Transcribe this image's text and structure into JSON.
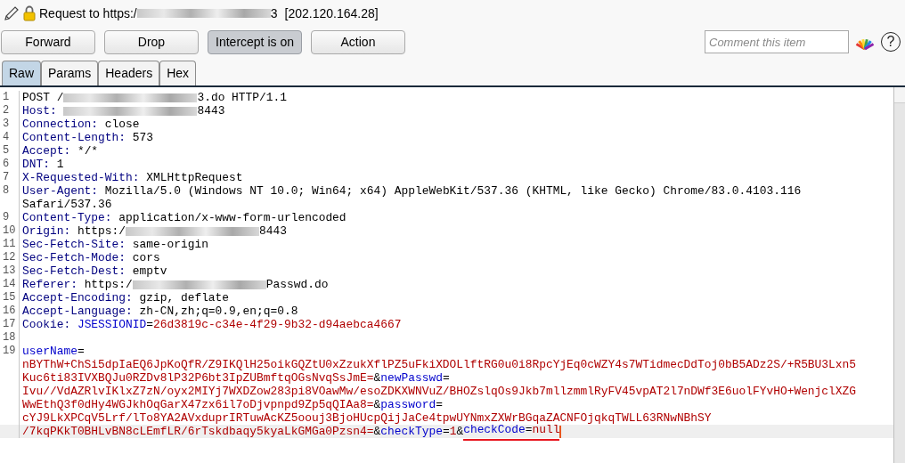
{
  "title": {
    "segments": [
      {
        "kind": "text",
        "text": "Request to https:/"
      },
      {
        "kind": "redacted"
      },
      {
        "kind": "text",
        "text": "3"
      }
    ],
    "address": "[202.120.164.28]"
  },
  "buttons": [
    {
      "label": "Forward",
      "pressed": false
    },
    {
      "label": "Drop",
      "pressed": false
    },
    {
      "label": "Intercept is on",
      "pressed": true
    },
    {
      "label": "Action",
      "pressed": false
    }
  ],
  "comment": {
    "placeholder": "Comment this item"
  },
  "help": "?",
  "tabs": [
    {
      "label": "Raw",
      "selected": true
    },
    {
      "label": "Params",
      "selected": false
    },
    {
      "label": "Headers",
      "selected": false
    },
    {
      "label": "Hex",
      "selected": false
    }
  ],
  "editor": {
    "rows": [
      {
        "number": "1",
        "current": false,
        "segments": [
          {
            "kind": "plain",
            "text": "POST /"
          },
          {
            "kind": "redacted"
          },
          {
            "kind": "plain",
            "text": "3.do HTTP/1.1"
          }
        ]
      },
      {
        "number": "2",
        "current": false,
        "segments": [
          {
            "kind": "name",
            "text": "Host: "
          },
          {
            "kind": "redacted"
          },
          {
            "kind": "plain",
            "text": "8443"
          }
        ]
      },
      {
        "number": "3",
        "current": false,
        "segments": [
          {
            "kind": "name",
            "text": "Connection:"
          },
          {
            "kind": "plain",
            "text": " close"
          }
        ]
      },
      {
        "number": "4",
        "current": false,
        "segments": [
          {
            "kind": "name",
            "text": "Content-Length:"
          },
          {
            "kind": "plain",
            "text": " 573"
          }
        ]
      },
      {
        "number": "5",
        "current": false,
        "segments": [
          {
            "kind": "name",
            "text": "Accept:"
          },
          {
            "kind": "plain",
            "text": " */*"
          }
        ]
      },
      {
        "number": "6",
        "current": false,
        "segments": [
          {
            "kind": "name",
            "text": "DNT:"
          },
          {
            "kind": "plain",
            "text": " 1"
          }
        ]
      },
      {
        "number": "7",
        "current": false,
        "segments": [
          {
            "kind": "name",
            "text": "X-Requested-With:"
          },
          {
            "kind": "plain",
            "text": " XMLHttpRequest"
          }
        ]
      },
      {
        "number": "8",
        "current": false,
        "segments": [
          {
            "kind": "name",
            "text": "User-Agent:"
          },
          {
            "kind": "plain",
            "text": " Mozilla/5.0 (Windows NT 10.0; Win64; x64) AppleWebKit/537.36 (KHTML, like Gecko) Chrome/83.0.4103.116"
          }
        ]
      },
      {
        "current": false,
        "segments": [
          {
            "kind": "plain",
            "text": "Safari/537.36"
          }
        ]
      },
      {
        "number": "9",
        "current": false,
        "segments": [
          {
            "kind": "name",
            "text": "Content-Type:"
          },
          {
            "kind": "plain",
            "text": " application/x-www-form-urlencoded"
          }
        ]
      },
      {
        "number": "10",
        "current": false,
        "segments": [
          {
            "kind": "name",
            "text": "Origin:"
          },
          {
            "kind": "plain",
            "text": " https:/"
          },
          {
            "kind": "redacted"
          },
          {
            "kind": "plain",
            "text": "8443"
          }
        ]
      },
      {
        "number": "11",
        "current": false,
        "segments": [
          {
            "kind": "name",
            "text": "Sec-Fetch-Site:"
          },
          {
            "kind": "plain",
            "text": " same-origin"
          }
        ]
      },
      {
        "number": "12",
        "current": false,
        "segments": [
          {
            "kind": "name",
            "text": "Sec-Fetch-Mode:"
          },
          {
            "kind": "plain",
            "text": " cors"
          }
        ]
      },
      {
        "number": "13",
        "current": false,
        "segments": [
          {
            "kind": "name",
            "text": "Sec-Fetch-Dest:"
          },
          {
            "kind": "plain",
            "text": " emptv"
          }
        ]
      },
      {
        "number": "14",
        "current": false,
        "segments": [
          {
            "kind": "name",
            "text": "Referer:"
          },
          {
            "kind": "plain",
            "text": " https:/"
          },
          {
            "kind": "redacted"
          },
          {
            "kind": "plain",
            "text": "Passwd.do"
          }
        ]
      },
      {
        "number": "15",
        "current": false,
        "segments": [
          {
            "kind": "name",
            "text": "Accept-Encoding:"
          },
          {
            "kind": "plain",
            "text": " gzip, deflate"
          }
        ]
      },
      {
        "number": "16",
        "current": false,
        "segments": [
          {
            "kind": "name",
            "text": "Accept-Language:"
          },
          {
            "kind": "plain",
            "text": " zh-CN,zh;q=0.9,en;q=0.8"
          }
        ]
      },
      {
        "number": "17",
        "current": false,
        "segments": [
          {
            "kind": "name",
            "text": "Cookie: "
          },
          {
            "kind": "param",
            "text": "JSESSIONID"
          },
          {
            "kind": "plain",
            "text": "="
          },
          {
            "kind": "value",
            "text": "26d3819c-c34e-4f29-9b32-d94aebca4667"
          }
        ]
      },
      {
        "number": "18",
        "current": false,
        "segments": []
      },
      {
        "number": "19",
        "current": false,
        "segments": [
          {
            "kind": "param",
            "text": "userName"
          },
          {
            "kind": "plain",
            "text": "="
          }
        ]
      },
      {
        "current": false,
        "segments": [
          {
            "kind": "value",
            "text": "nBYThW+ChSi5dpIaEQ6JpKoQfR/Z9IKQlH25oikGQZtU0xZzukXflPZ5uFkiXDOLlftRG0u0i8RpcYjEq0cWZY4s7WTidmecDdToj0bB5ADz2S/+R5BU3Lxn5"
          }
        ]
      },
      {
        "current": false,
        "segments": [
          {
            "kind": "value",
            "text": "Kuc6ti83IVXBQJu0RZDv8lP32P6bt3IpZUBmftqOGsNvqSsJmE="
          },
          {
            "kind": "plain",
            "text": "&"
          },
          {
            "kind": "param",
            "text": "newPasswd"
          },
          {
            "kind": "plain",
            "text": "="
          }
        ]
      },
      {
        "current": false,
        "segments": [
          {
            "kind": "value",
            "text": "Ivu//VdAZRlvIKlxZ7zN/oyx2MIYj7WXDZow283pi8VOawMw/esoZDKXWNVuZ/BHOZslqOs9Jkb7mllzmmlRyFV45vpAT2l7nDWf3E6uolFYvHO+WenjclXZG"
          }
        ]
      },
      {
        "current": false,
        "segments": [
          {
            "kind": "value",
            "text": "WwEthQ3f0dHy4WGJkhOqGarX47zx6il7oDjvpnpd9Zp5qQIAa8="
          },
          {
            "kind": "plain",
            "text": "&"
          },
          {
            "kind": "param",
            "text": "password"
          },
          {
            "kind": "plain",
            "text": "="
          }
        ]
      },
      {
        "current": false,
        "segments": [
          {
            "kind": "value",
            "text": "cYJ9LkXPCqV5Lrf/lTo8YA2AVxduprIRTuwAcKZ5oouj3BjoHUcpQijJaCe4tpwUYNmxZXWrBGqaZACNFOjqkqTWLL63RNwNBhSY"
          }
        ]
      },
      {
        "current": true,
        "segments": [
          {
            "kind": "value",
            "text": "/7kqPKkT0BHLvBN8cLEmfLR/6rTskdbaqy5kyaLkGMGa0Pzsn4="
          },
          {
            "kind": "plain",
            "text": "&"
          },
          {
            "kind": "param",
            "text": "checkType"
          },
          {
            "kind": "plain",
            "text": "="
          },
          {
            "kind": "value",
            "text": "1"
          },
          {
            "kind": "plain",
            "text": "&"
          },
          {
            "kind": "param",
            "text": "checkCode",
            "underlined": true
          },
          {
            "kind": "plain",
            "text": "=",
            "underlined": true
          },
          {
            "kind": "value",
            "text": "null",
            "underlined": true
          }
        ]
      }
    ]
  }
}
